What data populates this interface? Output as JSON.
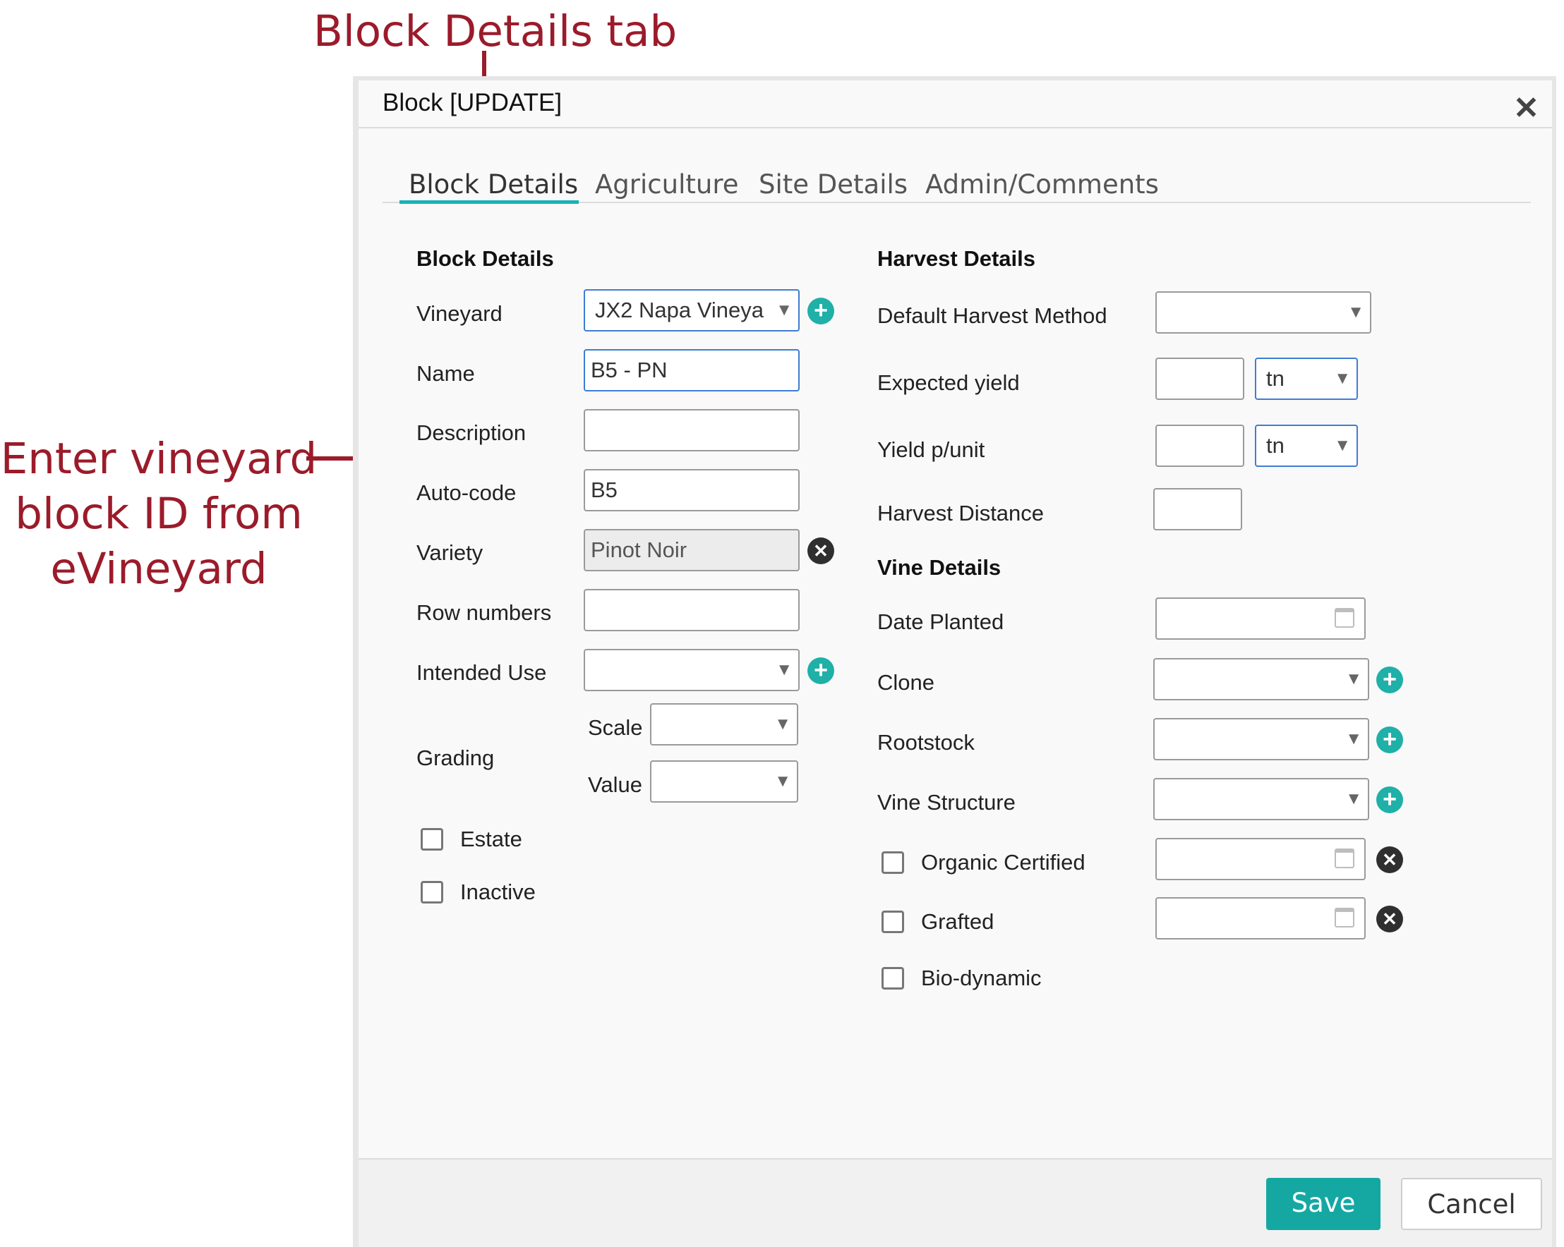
{
  "annotations": {
    "tab_callout": "Block Details tab",
    "field_callout_line1": "Enter vineyard",
    "field_callout_line2": "block ID from",
    "field_callout_line3": "eVineyard"
  },
  "dialog": {
    "title": "Block [UPDATE]",
    "close_label": "✕"
  },
  "tabs": [
    {
      "label": "Block Details",
      "active": true
    },
    {
      "label": "Agriculture"
    },
    {
      "label": "Site Details"
    },
    {
      "label": "Admin/Comments"
    }
  ],
  "block_details": {
    "heading": "Block Details",
    "vineyard_label": "Vineyard",
    "vineyard_value": "JX2 Napa Vineya",
    "name_label": "Name",
    "name_value": "B5 - PN",
    "description_label": "Description",
    "description_value": "",
    "autocode_label": "Auto-code",
    "autocode_value": "B5",
    "variety_label": "Variety",
    "variety_value": "Pinot Noir",
    "row_numbers_label": "Row numbers",
    "row_numbers_value": "",
    "intended_use_label": "Intended Use",
    "grading_label": "Grading",
    "scale_label": "Scale",
    "value_label": "Value",
    "estate_label": "Estate",
    "inactive_label": "Inactive"
  },
  "harvest_details": {
    "heading": "Harvest Details",
    "default_method_label": "Default Harvest Method",
    "expected_yield_label": "Expected yield",
    "expected_yield_unit": "tn",
    "yield_punit_label": "Yield p/unit",
    "yield_punit_unit": "tn",
    "harvest_distance_label": "Harvest Distance"
  },
  "vine_details": {
    "heading": "Vine Details",
    "date_planted_label": "Date Planted",
    "clone_label": "Clone",
    "rootstock_label": "Rootstock",
    "vine_structure_label": "Vine Structure",
    "organic_label": "Organic Certified",
    "grafted_label": "Grafted",
    "biodynamic_label": "Bio-dynamic"
  },
  "footer": {
    "save_label": "Save",
    "cancel_label": "Cancel"
  },
  "icons": {
    "dropdown_arrow": "▼",
    "plus": "+",
    "clear": "✕"
  },
  "colors": {
    "annotation": "#9b1b2a",
    "accent": "#15a8a3",
    "tab_underline": "#18b3b5"
  }
}
